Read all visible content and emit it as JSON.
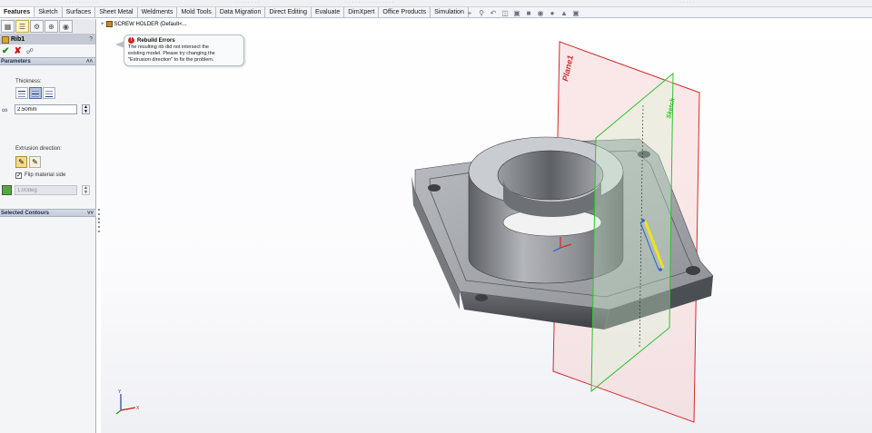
{
  "command_manager": {
    "tabs": [
      "Features",
      "Sketch",
      "Surfaces",
      "Sheet Metal",
      "Weldments",
      "Mold Tools",
      "Data Migration",
      "Direct Editing",
      "Evaluate",
      "DimXpert",
      "Office Products",
      "Simulation"
    ],
    "active_tab": "Features"
  },
  "property_manager": {
    "title": "Rib1",
    "help": "?",
    "parameters_header": "Parameters",
    "thickness_label": "Thickness:",
    "thickness_value": "2.50mm",
    "extrusion_direction_label": "Extrusion direction:",
    "flip_material_side_label": "Flip material side",
    "flip_material_side_checked": true,
    "draft_value": "1.00deg",
    "selected_contours_header": "Selected Contours"
  },
  "feature_tree_flyout": {
    "label": "SCREW HOLDER  (Default<..."
  },
  "rebuild_error": {
    "title": "Rebuild Errors",
    "message_lines": [
      "The resulting rib did not intersect the",
      "existing model.  Please try changing the",
      "\"Extrusion direction\" to fix the problem."
    ]
  },
  "viewport": {
    "plane_label": "Plane1",
    "sketch_plane_label": "Sketch"
  },
  "colors": {
    "plane_red": "#d42a2a",
    "sketch_green": "#2bc42b",
    "rib_yellow": "#f0e21a",
    "model_gray": "#8c8f93"
  }
}
